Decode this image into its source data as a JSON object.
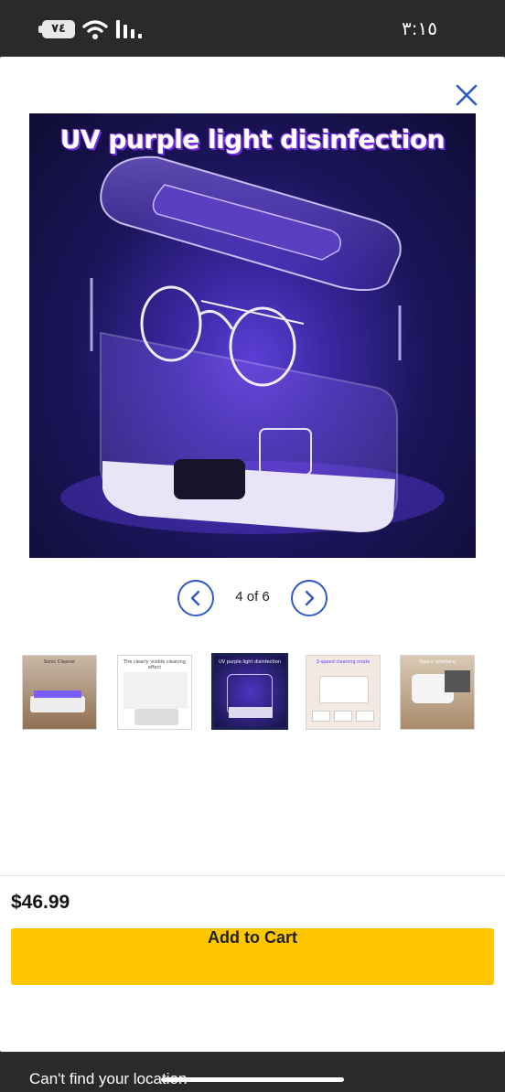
{
  "status_bar": {
    "battery": "٧٤",
    "time": "٣:١٥"
  },
  "gallery": {
    "hero_caption": "UV purple light disinfection",
    "position_text": "4 of 6",
    "thumbnails": [
      {
        "caption": "Sonic Cleaner"
      },
      {
        "caption": "The clearly visible cleaning effect"
      },
      {
        "caption": "UV purple light disinfection"
      },
      {
        "caption": "3-speed cleaning mode"
      },
      {
        "caption": "Type-c interface"
      }
    ]
  },
  "product": {
    "price": "$46.99",
    "add_to_cart_label": "Add to Cart"
  },
  "footer": {
    "message": "Can't find your location"
  },
  "colors": {
    "accent_blue": "#2f5ac6",
    "cart_yellow": "#ffc700",
    "selected_thumb_border": "#1b2350"
  },
  "icons": {
    "close": "close-icon",
    "prev": "chevron-left-icon",
    "next": "chevron-right-icon"
  }
}
